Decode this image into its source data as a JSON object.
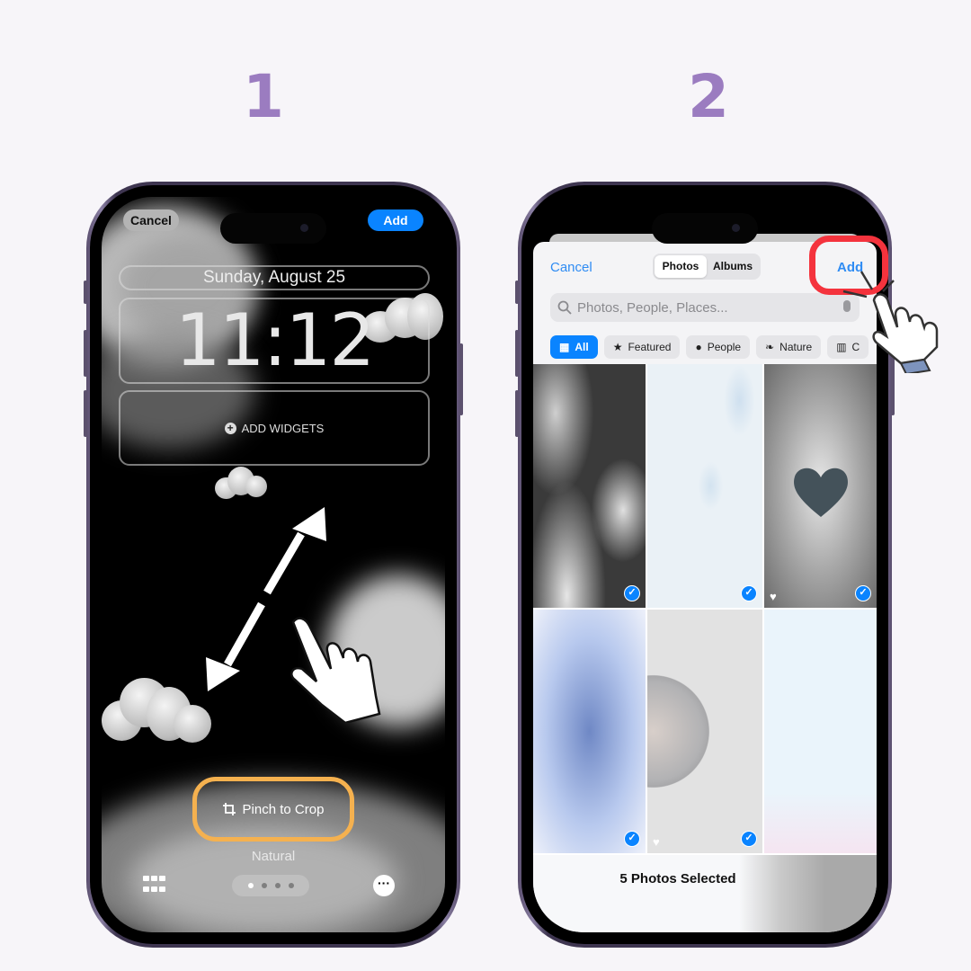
{
  "steps": [
    {
      "number": "1"
    },
    {
      "number": "2"
    }
  ],
  "lock_screen": {
    "cancel_label": "Cancel",
    "add_label": "Add",
    "date": "Sunday, August 25",
    "time": "11:12",
    "add_widgets_label": "ADD WIDGETS",
    "pinch_to_crop_label": "Pinch to Crop",
    "filter_name": "Natural",
    "pager": {
      "total": 4,
      "active_index": 0
    },
    "icons": [
      "crop-icon",
      "grid-icon",
      "more-icon",
      "pinch-arrow-icon",
      "hand-pointer-icon"
    ]
  },
  "photo_picker": {
    "cancel_label": "Cancel",
    "segments": [
      {
        "label": "Photos",
        "selected": true
      },
      {
        "label": "Albums",
        "selected": false
      }
    ],
    "add_label": "Add",
    "search_placeholder": "Photos, People, Places...",
    "chips": [
      {
        "label": "All",
        "icon": "grid-icon",
        "selected": true
      },
      {
        "label": "Featured",
        "icon": "star-icon",
        "selected": false
      },
      {
        "label": "People",
        "icon": "person-icon",
        "selected": false
      },
      {
        "label": "Nature",
        "icon": "leaf-icon",
        "selected": false
      },
      {
        "label": "C",
        "icon": "building-icon",
        "selected": false
      }
    ],
    "photos": [
      {
        "desc": "night clouds moon",
        "selected": true,
        "favorite": false
      },
      {
        "desc": "light blue clouds",
        "selected": true,
        "favorite": false
      },
      {
        "desc": "gray heart",
        "selected": true,
        "favorite": true
      },
      {
        "desc": "blue gradient",
        "selected": true,
        "favorite": false
      },
      {
        "desc": "gray planet",
        "selected": true,
        "favorite": true
      },
      {
        "desc": "pale blue pink gradient",
        "selected": false,
        "favorite": false
      }
    ],
    "selection_status": "5 Photos Selected"
  },
  "colors": {
    "step_number": "#9b7cc0",
    "ios_blue": "#0a84ff",
    "highlight_orange": "#f5b14f",
    "highlight_red": "#f4333d"
  }
}
